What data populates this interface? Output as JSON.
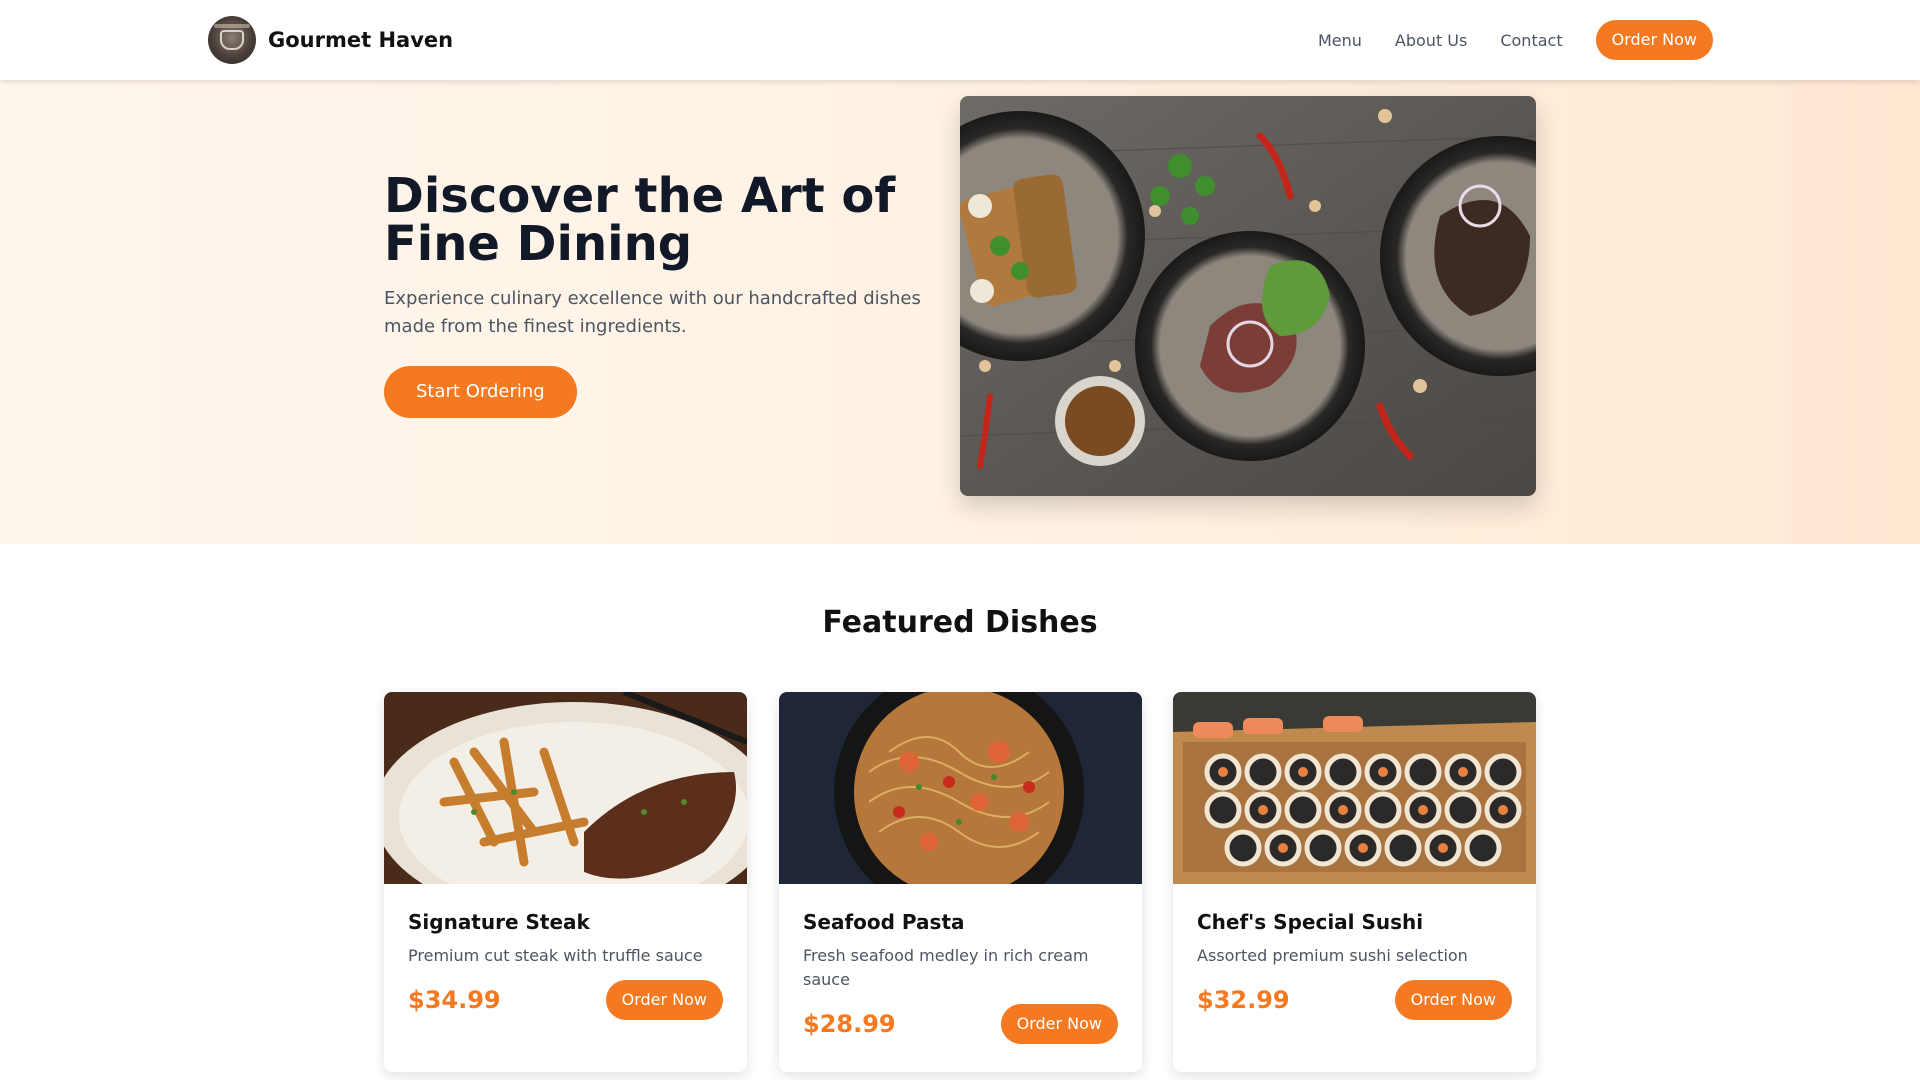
{
  "header": {
    "brand_name": "Gourmet Haven",
    "nav": [
      "Menu",
      "About Us",
      "Contact"
    ],
    "order_label": "Order Now"
  },
  "hero": {
    "title": "Discover the Art of Fine Dining",
    "subtitle": "Experience culinary excellence with our handcrafted dishes made from the finest ingredients.",
    "cta_label": "Start Ordering"
  },
  "featured": {
    "title": "Featured Dishes",
    "dishes": [
      {
        "name": "Signature Steak",
        "description": "Premium cut steak with truffle sauce",
        "price": "$34.99",
        "order_label": "Order Now"
      },
      {
        "name": "Seafood Pasta",
        "description": "Fresh seafood medley in rich cream sauce",
        "price": "$28.99",
        "order_label": "Order Now"
      },
      {
        "name": "Chef's Special Sushi",
        "description": "Assorted premium sushi selection",
        "price": "$32.99",
        "order_label": "Order Now"
      }
    ]
  },
  "colors": {
    "accent": "#f47920",
    "hero_bg": "#fff3e6",
    "text_dark": "#111827",
    "text_muted": "#4b5563"
  }
}
